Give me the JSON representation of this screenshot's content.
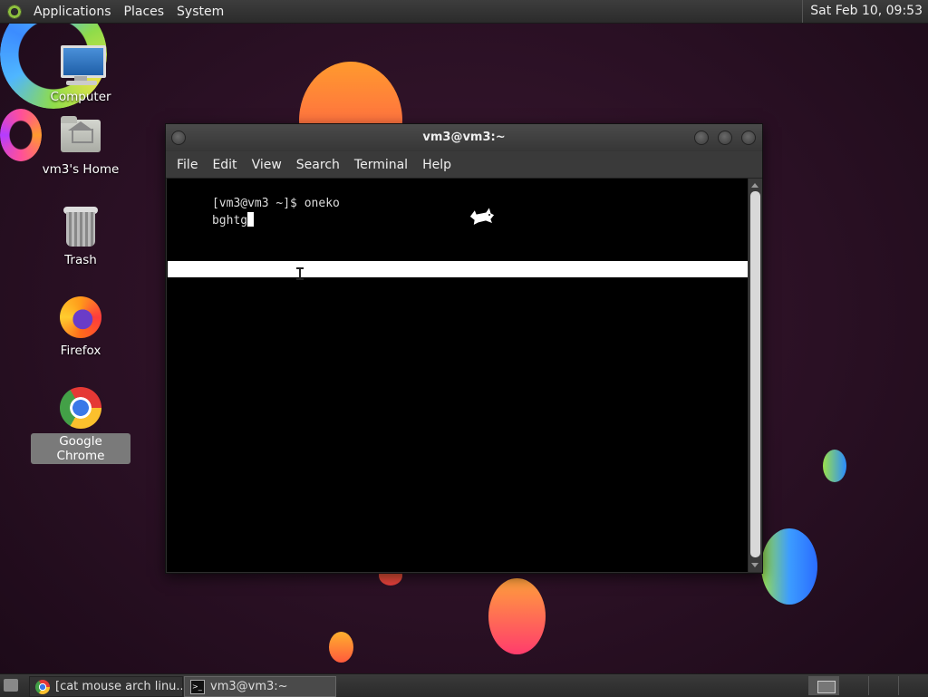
{
  "top_panel": {
    "menus": [
      "Applications",
      "Places",
      "System"
    ],
    "clock": "Sat Feb 10, 09:53"
  },
  "desktop": {
    "icons": [
      {
        "label": "Computer",
        "icon": "computer-icon"
      },
      {
        "label": "vm3's Home",
        "icon": "home-folder-icon"
      },
      {
        "label": "Trash",
        "icon": "trash-icon"
      },
      {
        "label": "Firefox",
        "icon": "firefox-icon"
      },
      {
        "label": "Google Chrome",
        "icon": "chrome-icon",
        "selected": true
      }
    ]
  },
  "terminal_window": {
    "title": "vm3@vm3:~",
    "menu": [
      "File",
      "Edit",
      "View",
      "Search",
      "Terminal",
      "Help"
    ],
    "lines": [
      "[vm3@vm3 ~]$ oneko",
      "bghtg"
    ]
  },
  "taskbar": {
    "tasks": [
      {
        "label": "[cat mouse arch linu...",
        "icon": "chrome-icon"
      },
      {
        "label": "vm3@vm3:~",
        "icon": "terminal-icon",
        "active": true
      }
    ]
  }
}
